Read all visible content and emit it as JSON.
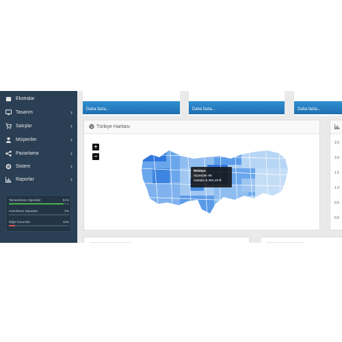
{
  "sidebar": {
    "items": [
      {
        "label": "Ekstralar",
        "icon": "puzzle-icon"
      },
      {
        "label": "Tasarım",
        "icon": "monitor-icon"
      },
      {
        "label": "Satışlar",
        "icon": "cart-icon"
      },
      {
        "label": "Müşteriler",
        "icon": "user-icon"
      },
      {
        "label": "Pazarlama",
        "icon": "share-icon"
      },
      {
        "label": "Sistem",
        "icon": "gear-icon"
      },
      {
        "label": "Raporlar",
        "icon": "bar-chart-icon"
      }
    ],
    "stats": [
      {
        "label": "Tamamlanan Siparişler",
        "pct": "91%",
        "value": 91,
        "color": "#4caf50"
      },
      {
        "label": "Hazırlanan Siparişler",
        "pct": "0%",
        "value": 0,
        "color": "#f0ad4e"
      },
      {
        "label": "Diğer Durumlar",
        "pct": "10%",
        "value": 10,
        "color": "#d9534f"
      }
    ]
  },
  "tiles": [
    {
      "more": "Daha fazla..."
    },
    {
      "more": "Daha fazla..."
    },
    {
      "more": "Daha fazla..."
    }
  ],
  "map_panel": {
    "title": "Türkiye Haritası",
    "icon": "globe-icon",
    "zoom_in": "+",
    "zoom_out": "−",
    "tooltip": {
      "title": "Malatya",
      "orders": "Siparişler 68",
      "sales": "Satışlar 6.364,29 ₺"
    }
  },
  "chart_panel": {
    "icon": "bar-chart-icon",
    "y_labels": [
      "2.5",
      "2.0",
      "1.5",
      "1.0",
      "0.5",
      "0.0"
    ]
  },
  "colors": {
    "sidebar": "#2a3f54",
    "tile_blue": "#1f6fb0",
    "map_light": "#a9cdf2",
    "map_mid": "#6aa6ec",
    "map_dark": "#2f76dc"
  }
}
